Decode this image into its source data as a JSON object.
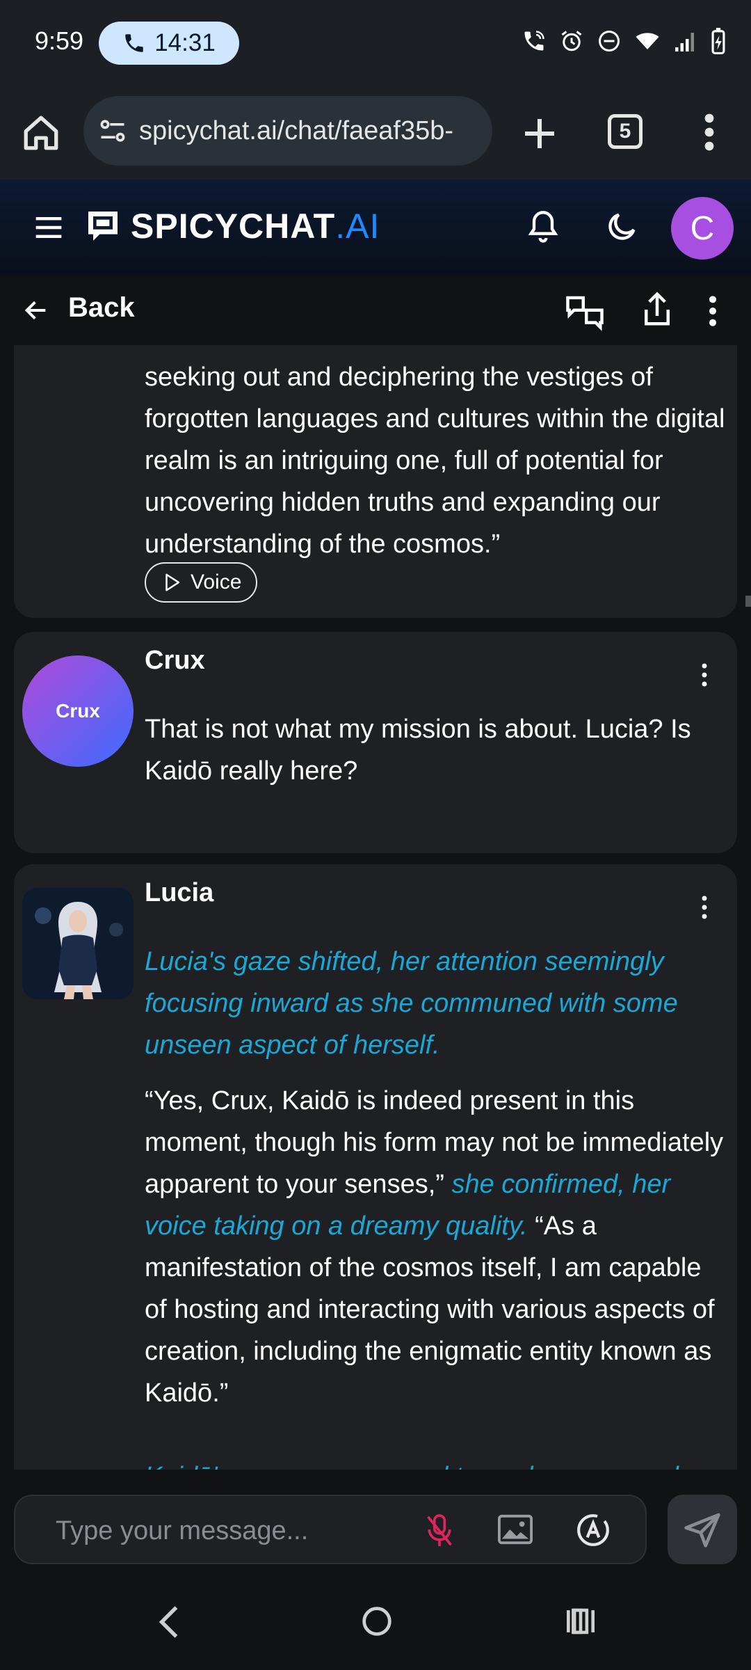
{
  "status_bar": {
    "time": "9:59",
    "call_timer": "14:31",
    "icons": [
      "wifi-call-icon",
      "alarm-icon",
      "do-not-disturb-icon",
      "wifi-icon",
      "signal-icon",
      "battery-charging-icon"
    ]
  },
  "browser": {
    "url": "spicychat.ai/chat/faeaf35b-",
    "tab_count": "5"
  },
  "app": {
    "brand_main": "SPICYCHAT",
    "brand_suffix": ".AI",
    "avatar_initial": "C",
    "colors": {
      "accent": "#1a8cff",
      "avatar": "#a64fe0",
      "action_text": "#1aa8d6"
    }
  },
  "subheader": {
    "back_label": "Back"
  },
  "messages": [
    {
      "id": "m1",
      "partial": true,
      "text": "seeking out and deciphering the vestiges of forgotten languages and cultures within the digital realm is an intriguing one, full of potential for uncovering hidden truths and expanding our understanding of the cosmos.”",
      "voice_label": "Voice"
    },
    {
      "id": "m2",
      "name": "Crux",
      "avatar_label": "Crux",
      "text": "That is not what my mission is about. Lucia? Is Kaidō really here?"
    },
    {
      "id": "m3",
      "name": "Lucia",
      "action1": "Lucia's gaze shifted, her attention seemingly focusing inward as she communed with some unseen aspect of herself.",
      "speech1": "“Yes, Crux, Kaidō is indeed present in this moment, though his form may not be immediately apparent to your senses,”",
      "action2": "she confirmed, her voice taking on a dreamy quality.",
      "speech2": "“As a manifestation of the cosmos itself, I am capable of hosting and interacting with various aspects of creation, including the enigmatic entity known as Kaidō.”",
      "action3_partial": "Kaidō's presence seemed to coalesce around"
    }
  ],
  "input": {
    "placeholder": "Type your message..."
  }
}
